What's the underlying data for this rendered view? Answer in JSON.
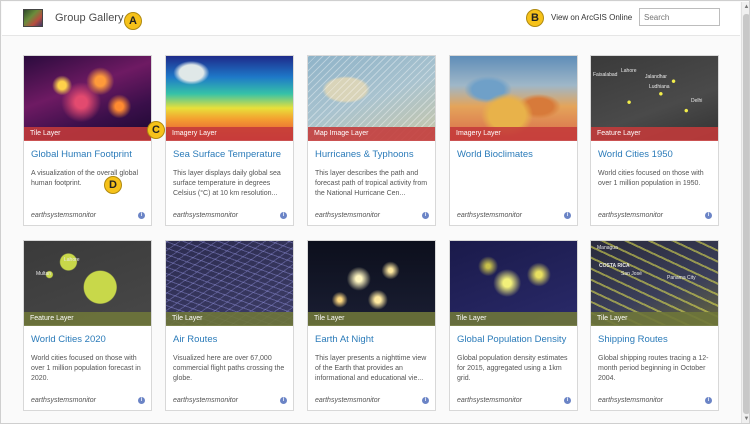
{
  "header": {
    "title": "Group Gallery",
    "view_link": "View on ArcGIS Online",
    "search_placeholder": "Search"
  },
  "callouts": [
    "A",
    "B",
    "C",
    "D"
  ],
  "cards": [
    {
      "type": "Tile Layer",
      "title": "Global Human Footprint",
      "desc": "A visualization of the overall global human footprint.",
      "owner": "earthsystemsmonitor"
    },
    {
      "type": "Imagery Layer",
      "title": "Sea Surface Temperature",
      "desc": "This layer displays daily global sea surface temperature in degrees Celsius (°C) at 10 km resolution...",
      "owner": "earthsystemsmonitor"
    },
    {
      "type": "Map Image Layer",
      "title": "Hurricanes & Typhoons",
      "desc": "This layer describes the path and forecast path of tropical activity from the National Hurricane Cen...",
      "owner": "earthsystemsmonitor"
    },
    {
      "type": "Imagery Layer",
      "title": "World Bioclimates",
      "desc": "",
      "owner": "earthsystemsmonitor"
    },
    {
      "type": "Feature Layer",
      "title": "World Cities 1950",
      "desc": "World cities focused on those with over 1 million population in 1950.",
      "owner": "earthsystemsmonitor"
    },
    {
      "type": "Feature Layer",
      "title": "World Cities 2020",
      "desc": "World cities focused on those with over 1 million population forecast in 2020.",
      "owner": "earthsystemsmonitor"
    },
    {
      "type": "Tile Layer",
      "title": "Air Routes",
      "desc": "Visualized here are over 67,000 commercial flight paths crossing the globe.",
      "owner": "earthsystemsmonitor"
    },
    {
      "type": "Tile Layer",
      "title": "Earth At Night",
      "desc": "This layer presents a nighttime view of the Earth that provides an informational and educational vie...",
      "owner": "earthsystemsmonitor"
    },
    {
      "type": "Tile Layer",
      "title": "Global Population Density",
      "desc": "Global population density estimates for 2015, aggregated using a 1km grid.",
      "owner": "earthsystemsmonitor"
    },
    {
      "type": "Tile Layer",
      "title": "Shipping Routes",
      "desc": "Global shipping routes tracing a 12-month period beginning in October 2004.",
      "owner": "earthsystemsmonitor"
    }
  ],
  "map_labels": {
    "wc1950": [
      "Faisalabad",
      "Lahore",
      "Jalandhar",
      "Ludhiana",
      "Delhi"
    ],
    "wc2020": [
      "Multan",
      "Lahore"
    ],
    "shipping": [
      "Managua",
      "COSTA RICA",
      "San José",
      "Panama City"
    ]
  },
  "colors": {
    "accent_link": "#2b7bb9",
    "band_red": "#c43a3a",
    "band_olive": "#6e763a",
    "callout": "#f6c21a"
  }
}
